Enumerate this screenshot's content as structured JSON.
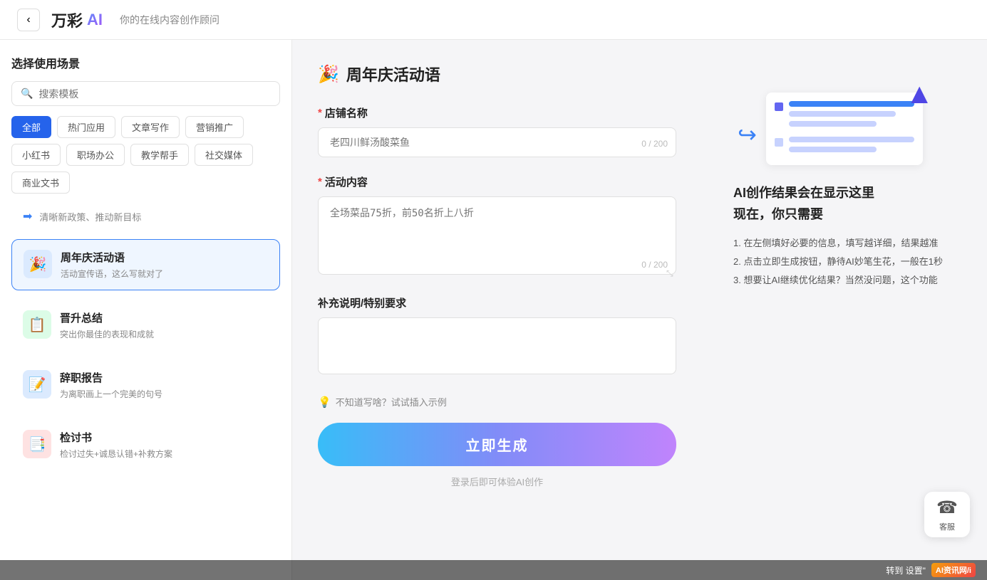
{
  "header": {
    "back_label": "‹",
    "logo_text": "万彩",
    "logo_ai": "AI",
    "subtitle": "你的在线内容创作顾问"
  },
  "sidebar": {
    "title": "选择使用场景",
    "search_placeholder": "搜索模板",
    "tags": [
      {
        "label": "全部",
        "active": true
      },
      {
        "label": "热门应用",
        "active": false
      },
      {
        "label": "文章写作",
        "active": false
      },
      {
        "label": "营销推广",
        "active": false
      },
      {
        "label": "小红书",
        "active": false
      },
      {
        "label": "职场办公",
        "active": false
      },
      {
        "label": "教学帮手",
        "active": false
      },
      {
        "label": "社交媒体",
        "active": false
      },
      {
        "label": "商业文书",
        "active": false
      }
    ],
    "top_item": {
      "text": "清晰新政策、推动新目标"
    },
    "items": [
      {
        "icon": "🎉",
        "icon_style": "blue",
        "title": "周年庆活动语",
        "desc": "活动宣传语，这么写就对了",
        "selected": true
      },
      {
        "icon": "📋",
        "icon_style": "green",
        "title": "晋升总结",
        "desc": "突出你最佳的表现和成就",
        "selected": false
      },
      {
        "icon": "📝",
        "icon_style": "blue",
        "title": "辞职报告",
        "desc": "为离职画上一个完美的句号",
        "selected": false
      },
      {
        "icon": "📑",
        "icon_style": "red",
        "title": "检讨书",
        "desc": "检讨过失+诚恳认错+补救方案",
        "selected": false
      }
    ]
  },
  "form": {
    "title": "周年庆活动语",
    "title_icon": "🎉",
    "fields": [
      {
        "label": "店铺名称",
        "required": true,
        "placeholder": "老四川鲜汤酸菜鱼",
        "type": "input",
        "char_count": "0 / 200"
      },
      {
        "label": "活动内容",
        "required": true,
        "placeholder": "全场菜品75折，前50名折上八折",
        "type": "textarea",
        "char_count": "0 / 200"
      },
      {
        "label": "补充说明/特别要求",
        "required": false,
        "placeholder": "",
        "type": "textarea_short",
        "char_count": ""
      }
    ],
    "hint_text": "不知道写啥？试试插入示例",
    "generate_button": "立即生成",
    "generate_hint": "登录后即可体验AI创作"
  },
  "right_panel": {
    "ai_hint_title": "AI创作结果会在显示这里",
    "ai_hint_subtitle": "现在，你只需要",
    "steps": [
      "1. 在左侧填好必要的信息，填写越详细，结果越准",
      "2. 点击立即生成按钮，静待AI妙笔生花，一般在1秒",
      "3. 想要让AI继续优化结果？当然没问题，这个功能"
    ]
  },
  "customer_service": {
    "icon": "☎",
    "label": "客服"
  },
  "watermark": {
    "prefix": "转到 设置\"",
    "logo": "AI资讯网/i"
  }
}
